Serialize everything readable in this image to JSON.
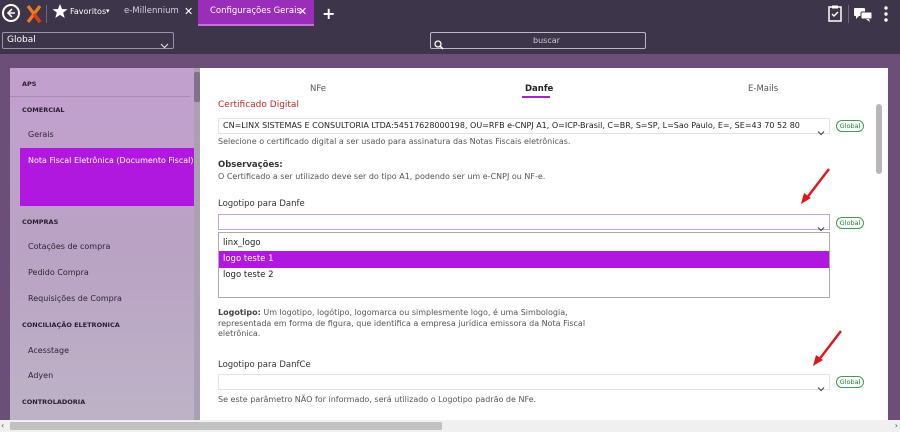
{
  "topbar": {
    "favorites_label": "Favoritos",
    "favorites_arrow": "▾",
    "tabs": [
      {
        "label": "e-Millennium"
      },
      {
        "label": "Configurações Gerais"
      }
    ],
    "close_glyph": "✕",
    "add_glyph": "+"
  },
  "bar2": {
    "scope_select": "Global",
    "search_placeholder": "buscar"
  },
  "sidebar": {
    "sections": [
      {
        "title": "APS"
      },
      {
        "title": "COMERCIAL"
      },
      {
        "title": "COMPRAS"
      },
      {
        "title": "CONCILIAÇÃO ELETRONICA"
      },
      {
        "title": "CONTROLADORIA"
      }
    ],
    "items": [
      {
        "label": "Gerais"
      },
      {
        "label": "Nota Fiscal Eletrônica (Documento Fiscal)"
      },
      {
        "label": "Cotações de compra"
      },
      {
        "label": "Pedido Compra"
      },
      {
        "label": "Requisições de Compra"
      },
      {
        "label": "Acesstage"
      },
      {
        "label": "Adyen"
      }
    ]
  },
  "content": {
    "tabs": [
      {
        "label": "NFe"
      },
      {
        "label": "Danfe"
      },
      {
        "label": "E-Mails"
      }
    ],
    "cert_label": "Certificado Digital",
    "cert_value": "CN=LINX SISTEMAS E CONSULTORIA LTDA:54517628000198, OU=RFB e-CNPJ A1, O=ICP-Brasil, C=BR, S=SP, L=Sao Paulo, E=, SE=43 70 52 80",
    "cert_hint": "Selecione o certificado digital a ser usado para assinatura das Notas Fiscais eletrônicas.",
    "obs_title": "Observações:",
    "obs_text": "O Certificado a ser utilizado deve ser do tipo A1, podendo ser um e-CNPJ ou NF-e.",
    "logo_danfe_label": "Logotipo para Danfe",
    "dropdown_options": [
      {
        "label": "linx_logo"
      },
      {
        "label": "logo teste 1"
      },
      {
        "label": "logo teste 2"
      }
    ],
    "logo_para_bold": "Logotipo:",
    "logo_para_text": " Um logotipo, logótipo, logomarca ou simplesmente logo, é uma Simbologia, representada em forma de figura, que identifica a empresa jurídica emissora da Nota Fiscal eletrônica.",
    "logo_danfce_label": "Logotipo para DanfCe",
    "danfce_hint": "Se este parâmetro NÃO for informado, será utilizado o Logotipo padrão de NFe.",
    "global_badge": "Global"
  },
  "colors": {
    "accent": "#9a2dba",
    "selected": "#b018e0",
    "badge": "#3aa04b",
    "arrow": "#e0161b",
    "required_label": "#c4281f"
  },
  "hscroll": {
    "left_glyph": "‹",
    "right_glyph": "›"
  }
}
